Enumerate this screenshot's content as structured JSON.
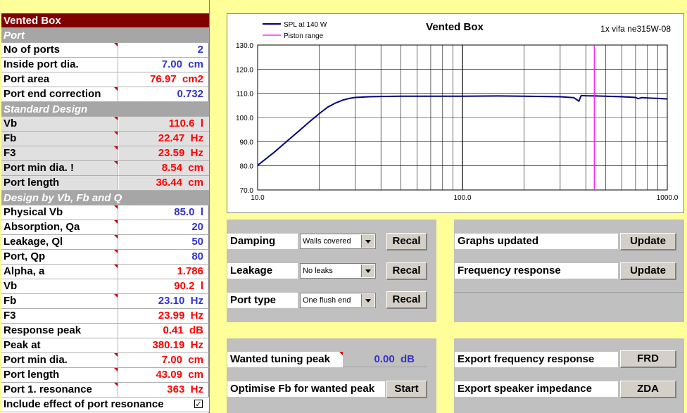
{
  "left_table": {
    "title": "Vented Box",
    "rows": [
      {
        "type": "section",
        "label": "Port"
      },
      {
        "label": "No of ports",
        "value": "2",
        "color": "blue",
        "tri": true
      },
      {
        "label": "Inside port dia.",
        "value": "7.00  cm",
        "color": "blue"
      },
      {
        "label": "Port area",
        "value": "76.97  cm2",
        "color": "red"
      },
      {
        "label": "Port end correction",
        "value": "0.732",
        "color": "blue",
        "tri": true
      },
      {
        "type": "section",
        "label": "Standard Design"
      },
      {
        "label": "Vb",
        "value": "110.6  l",
        "color": "red",
        "grey": true,
        "tri": true
      },
      {
        "label": "Fb",
        "value": "22.47  Hz",
        "color": "red",
        "grey": true,
        "tri": true
      },
      {
        "label": "F3",
        "value": "23.59  Hz",
        "color": "red",
        "grey": true,
        "tri": true
      },
      {
        "label": "Port min dia. !",
        "value": "8.54  cm",
        "color": "red",
        "grey": true,
        "tri": true
      },
      {
        "label": "Port length",
        "value": "36.44  cm",
        "color": "red",
        "grey": true
      },
      {
        "type": "section",
        "label": "Design by Vb, Fb and Q"
      },
      {
        "label": "Physical Vb",
        "value": "85.0  l",
        "color": "blue",
        "tri": true
      },
      {
        "label": "Absorption, Qa",
        "value": "20",
        "color": "blue",
        "tri": true
      },
      {
        "label": "Leakage, Ql",
        "value": "50",
        "color": "blue",
        "tri": true
      },
      {
        "label": "Port, Qp",
        "value": "80",
        "color": "blue",
        "tri": true
      },
      {
        "label": "Alpha, a",
        "value": "1.786",
        "color": "red",
        "tri": true
      },
      {
        "label": "Vb",
        "value": "90.2  l",
        "color": "red"
      },
      {
        "label": "Fb",
        "value": "23.10  Hz",
        "color": "blue",
        "tri": true
      },
      {
        "label": "F3",
        "value": "23.99  Hz",
        "color": "red"
      },
      {
        "label": "Response peak",
        "value": "0.41  dB",
        "color": "red"
      },
      {
        "label": "Peak at",
        "value": "380.19  Hz",
        "color": "red"
      },
      {
        "label": "Port min dia.",
        "value": "7.00  cm",
        "color": "red",
        "tri": true
      },
      {
        "label": "Port length",
        "value": "43.09  cm",
        "color": "red",
        "tri": true
      },
      {
        "label": "Port 1. resonance",
        "value": "363  Hz",
        "color": "red",
        "tri": true
      },
      {
        "label": "Include effect of port resonance",
        "value": "",
        "checkbox": true,
        "checked": "✓"
      }
    ]
  },
  "chart_data": {
    "type": "line",
    "title": "Vented Box",
    "subtitle": "1x vifa  ne315W-08",
    "xscale": "log",
    "xlim": [
      10,
      1000
    ],
    "ylim": [
      70,
      130
    ],
    "x_ticks": [
      "10.0",
      "100.0",
      "1000.0"
    ],
    "y_ticks": [
      "70.0",
      "80.0",
      "90.0",
      "100.0",
      "110.0",
      "120.0",
      "130.0"
    ],
    "legend": [
      "SPL at 140 W",
      "Piston range"
    ],
    "series": [
      {
        "name": "SPL at 140 W",
        "color": "#000080",
        "x": [
          10,
          12,
          14,
          16,
          18,
          20,
          22,
          24,
          26,
          28,
          30,
          35,
          40,
          50,
          60,
          80,
          100,
          150,
          200,
          300,
          350,
          370,
          380,
          400,
          450,
          500,
          600,
          700,
          720,
          750,
          800,
          900,
          1000
        ],
        "y": [
          80.2,
          85.5,
          90.4,
          94.6,
          98.4,
          101.6,
          104.3,
          106.0,
          107.2,
          107.9,
          108.3,
          108.6,
          108.7,
          108.8,
          108.8,
          108.8,
          108.8,
          108.9,
          108.8,
          108.6,
          108.2,
          106.8,
          109.1,
          109.0,
          108.9,
          108.8,
          108.6,
          108.3,
          107.8,
          108.2,
          108.1,
          107.9,
          107.7
        ]
      },
      {
        "name": "Piston range",
        "color": "#ff00ff",
        "x_marker": 440
      }
    ]
  },
  "settings": {
    "damping": {
      "label": "Damping",
      "value": "Walls covered",
      "button": "Recal"
    },
    "leakage": {
      "label": "Leakage",
      "value": "No leaks",
      "button": "Recal"
    },
    "port_type": {
      "label": "Port type",
      "value": "One flush end",
      "button": "Recal"
    }
  },
  "updates": {
    "graphs": {
      "label": "Graphs updated",
      "button": "Update"
    },
    "freq": {
      "label": "Frequency response",
      "button": "Update"
    }
  },
  "tuning": {
    "wanted_label": "Wanted tuning peak",
    "wanted_value": "0.00  dB",
    "optimise_label": "Optimise Fb for wanted peak",
    "start_button": "Start"
  },
  "export": {
    "frd_label": "Export frequency response",
    "frd_button": "FRD",
    "zda_label": "Export speaker impedance",
    "zda_button": "ZDA"
  }
}
